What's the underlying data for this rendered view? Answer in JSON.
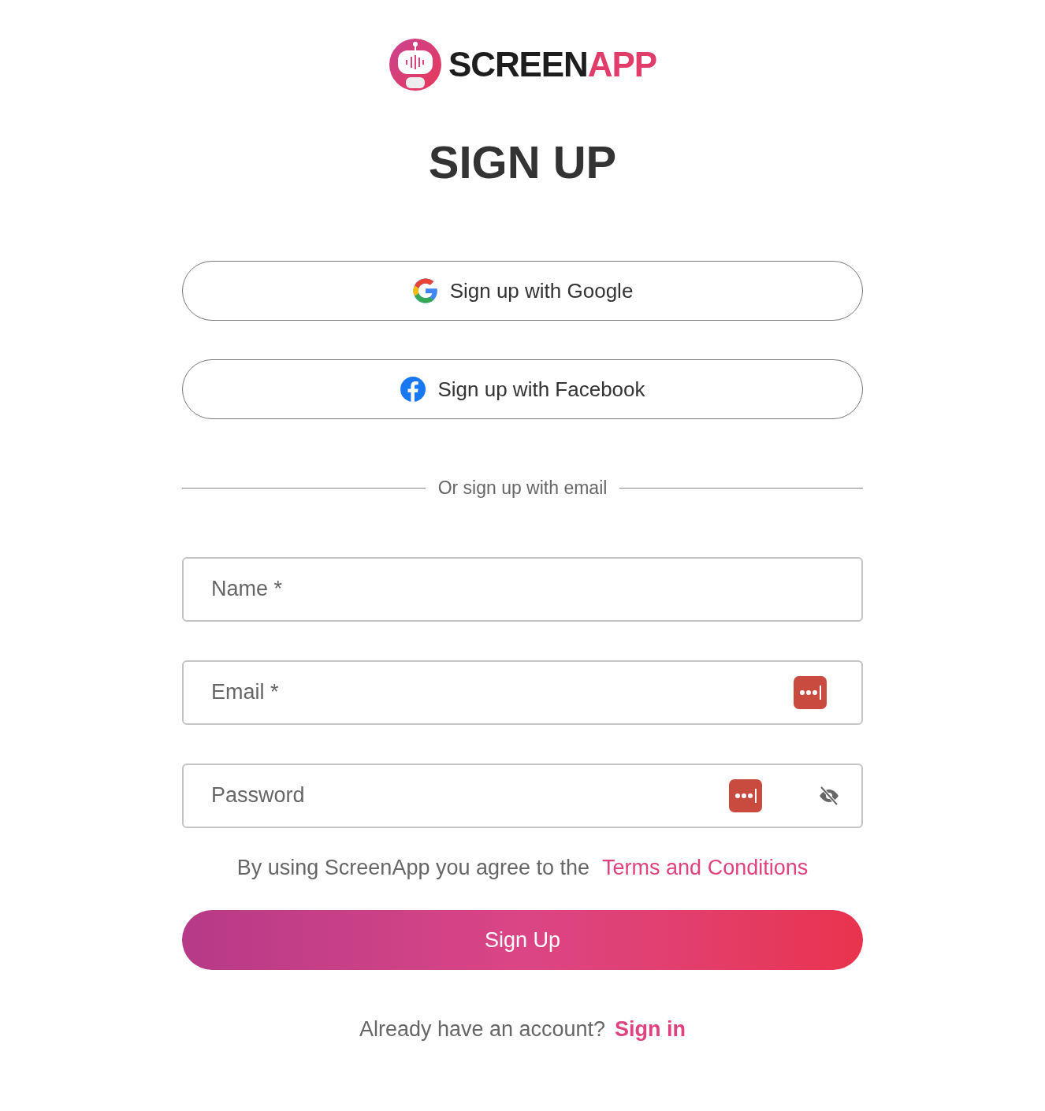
{
  "logo": {
    "part_1": "SCREEN",
    "part_2": "APP"
  },
  "title": "SIGN UP",
  "social_buttons": [
    {
      "kind": "google",
      "label": "Sign up with Google"
    },
    {
      "kind": "facebook",
      "label": "Sign up with Facebook"
    }
  ],
  "divider": "Or sign up with email",
  "fields": [
    {
      "kind": "text",
      "placeholder": "Name *"
    },
    {
      "kind": "email",
      "placeholder": "Email *"
    },
    {
      "kind": "password",
      "placeholder": "Password"
    }
  ],
  "terms": {
    "text": "By using ScreenApp you agree to the",
    "link": "Terms and Conditions"
  },
  "submit": "Sign Up",
  "footer": {
    "text": "Already have an account?",
    "link": "Sign in"
  }
}
